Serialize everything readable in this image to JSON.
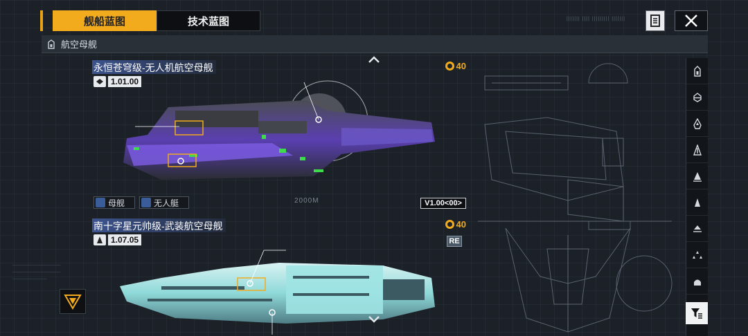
{
  "tabs": [
    {
      "label": "舰船蓝图",
      "active": true
    },
    {
      "label": "技术蓝图",
      "active": false
    }
  ],
  "category": {
    "title": "航空母舰"
  },
  "icons": {
    "document": "document-icon",
    "close": "close-icon",
    "filter": "filter-icon",
    "scroll_up": "chevron-up-icon",
    "scroll_down": "chevron-down-icon",
    "cost": "currency-icon",
    "corner": "emblem-icon"
  },
  "ships": [
    {
      "name": "永恒苍穹级-无人机航空母舰",
      "version": "1.01.00",
      "cost": "40",
      "tags": [
        "母舰",
        "无人艇"
      ],
      "distance": "2000M",
      "blueprint_version": "V1.00<00>",
      "hull_color": "#6b4fc8",
      "accent_color": "#3ddc4a"
    },
    {
      "name": "南十字星元帅级-武装航空母舰",
      "version": "1.07.05",
      "cost": "40",
      "badge": "RE",
      "hull_color": "#8fd9d9"
    }
  ],
  "side_filters": [
    "carrier-class-icon",
    "frigate-class-icon",
    "destroyer-class-icon",
    "cruiser-class-icon",
    "battlecruiser-class-icon",
    "battleship-class-icon",
    "auxiliary-class-icon",
    "fighter-class-icon",
    "corvette-class-icon"
  ],
  "colors": {
    "accent": "#f2ab1c",
    "background": "#1c2128",
    "name_highlight": "#425ca0"
  }
}
